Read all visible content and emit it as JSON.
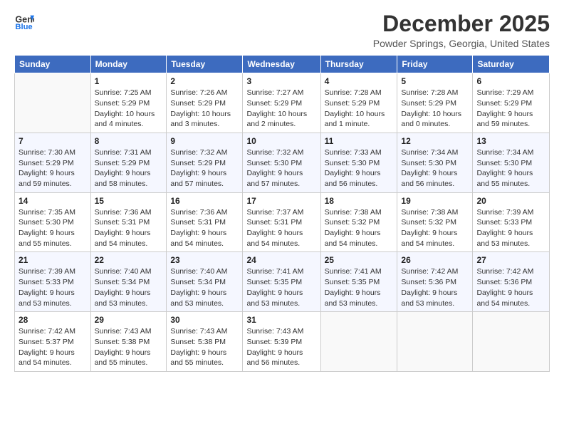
{
  "logo": {
    "line1": "General",
    "line2": "Blue"
  },
  "title": "December 2025",
  "location": "Powder Springs, Georgia, United States",
  "weekdays": [
    "Sunday",
    "Monday",
    "Tuesday",
    "Wednesday",
    "Thursday",
    "Friday",
    "Saturday"
  ],
  "weeks": [
    [
      {
        "day": "",
        "info": ""
      },
      {
        "day": "1",
        "info": "Sunrise: 7:25 AM\nSunset: 5:29 PM\nDaylight: 10 hours\nand 4 minutes."
      },
      {
        "day": "2",
        "info": "Sunrise: 7:26 AM\nSunset: 5:29 PM\nDaylight: 10 hours\nand 3 minutes."
      },
      {
        "day": "3",
        "info": "Sunrise: 7:27 AM\nSunset: 5:29 PM\nDaylight: 10 hours\nand 2 minutes."
      },
      {
        "day": "4",
        "info": "Sunrise: 7:28 AM\nSunset: 5:29 PM\nDaylight: 10 hours\nand 1 minute."
      },
      {
        "day": "5",
        "info": "Sunrise: 7:28 AM\nSunset: 5:29 PM\nDaylight: 10 hours\nand 0 minutes."
      },
      {
        "day": "6",
        "info": "Sunrise: 7:29 AM\nSunset: 5:29 PM\nDaylight: 9 hours\nand 59 minutes."
      }
    ],
    [
      {
        "day": "7",
        "info": "Sunrise: 7:30 AM\nSunset: 5:29 PM\nDaylight: 9 hours\nand 59 minutes."
      },
      {
        "day": "8",
        "info": "Sunrise: 7:31 AM\nSunset: 5:29 PM\nDaylight: 9 hours\nand 58 minutes."
      },
      {
        "day": "9",
        "info": "Sunrise: 7:32 AM\nSunset: 5:29 PM\nDaylight: 9 hours\nand 57 minutes."
      },
      {
        "day": "10",
        "info": "Sunrise: 7:32 AM\nSunset: 5:30 PM\nDaylight: 9 hours\nand 57 minutes."
      },
      {
        "day": "11",
        "info": "Sunrise: 7:33 AM\nSunset: 5:30 PM\nDaylight: 9 hours\nand 56 minutes."
      },
      {
        "day": "12",
        "info": "Sunrise: 7:34 AM\nSunset: 5:30 PM\nDaylight: 9 hours\nand 56 minutes."
      },
      {
        "day": "13",
        "info": "Sunrise: 7:34 AM\nSunset: 5:30 PM\nDaylight: 9 hours\nand 55 minutes."
      }
    ],
    [
      {
        "day": "14",
        "info": "Sunrise: 7:35 AM\nSunset: 5:30 PM\nDaylight: 9 hours\nand 55 minutes."
      },
      {
        "day": "15",
        "info": "Sunrise: 7:36 AM\nSunset: 5:31 PM\nDaylight: 9 hours\nand 54 minutes."
      },
      {
        "day": "16",
        "info": "Sunrise: 7:36 AM\nSunset: 5:31 PM\nDaylight: 9 hours\nand 54 minutes."
      },
      {
        "day": "17",
        "info": "Sunrise: 7:37 AM\nSunset: 5:31 PM\nDaylight: 9 hours\nand 54 minutes."
      },
      {
        "day": "18",
        "info": "Sunrise: 7:38 AM\nSunset: 5:32 PM\nDaylight: 9 hours\nand 54 minutes."
      },
      {
        "day": "19",
        "info": "Sunrise: 7:38 AM\nSunset: 5:32 PM\nDaylight: 9 hours\nand 54 minutes."
      },
      {
        "day": "20",
        "info": "Sunrise: 7:39 AM\nSunset: 5:33 PM\nDaylight: 9 hours\nand 53 minutes."
      }
    ],
    [
      {
        "day": "21",
        "info": "Sunrise: 7:39 AM\nSunset: 5:33 PM\nDaylight: 9 hours\nand 53 minutes."
      },
      {
        "day": "22",
        "info": "Sunrise: 7:40 AM\nSunset: 5:34 PM\nDaylight: 9 hours\nand 53 minutes."
      },
      {
        "day": "23",
        "info": "Sunrise: 7:40 AM\nSunset: 5:34 PM\nDaylight: 9 hours\nand 53 minutes."
      },
      {
        "day": "24",
        "info": "Sunrise: 7:41 AM\nSunset: 5:35 PM\nDaylight: 9 hours\nand 53 minutes."
      },
      {
        "day": "25",
        "info": "Sunrise: 7:41 AM\nSunset: 5:35 PM\nDaylight: 9 hours\nand 53 minutes."
      },
      {
        "day": "26",
        "info": "Sunrise: 7:42 AM\nSunset: 5:36 PM\nDaylight: 9 hours\nand 53 minutes."
      },
      {
        "day": "27",
        "info": "Sunrise: 7:42 AM\nSunset: 5:36 PM\nDaylight: 9 hours\nand 54 minutes."
      }
    ],
    [
      {
        "day": "28",
        "info": "Sunrise: 7:42 AM\nSunset: 5:37 PM\nDaylight: 9 hours\nand 54 minutes."
      },
      {
        "day": "29",
        "info": "Sunrise: 7:43 AM\nSunset: 5:38 PM\nDaylight: 9 hours\nand 55 minutes."
      },
      {
        "day": "30",
        "info": "Sunrise: 7:43 AM\nSunset: 5:38 PM\nDaylight: 9 hours\nand 55 minutes."
      },
      {
        "day": "31",
        "info": "Sunrise: 7:43 AM\nSunset: 5:39 PM\nDaylight: 9 hours\nand 56 minutes."
      },
      {
        "day": "",
        "info": ""
      },
      {
        "day": "",
        "info": ""
      },
      {
        "day": "",
        "info": ""
      }
    ]
  ]
}
